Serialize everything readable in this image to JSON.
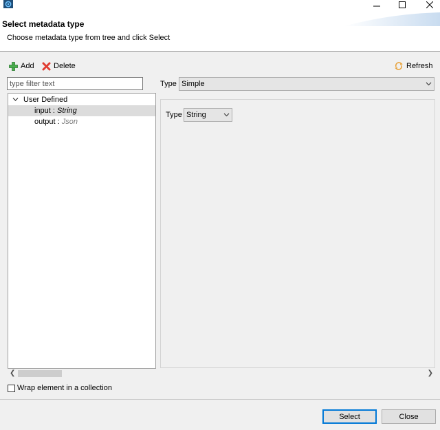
{
  "window": {
    "title_icon": "gear-app-icon",
    "controls": {
      "minimize_icon": "minimize-icon",
      "maximize_icon": "maximize-icon",
      "close_icon": "close-icon"
    }
  },
  "header": {
    "title": "Select metadata type",
    "subtitle": "Choose metadata type from tree and click Select"
  },
  "toolbar": {
    "add_label": "Add",
    "add_icon": "plus-icon",
    "delete_label": "Delete",
    "delete_icon": "delete-x-icon",
    "refresh_label": "Refresh",
    "refresh_icon": "refresh-icon"
  },
  "filter": {
    "placeholder": "type filter text",
    "value": ""
  },
  "tree": {
    "root": {
      "label": "User Defined",
      "expanded": true
    },
    "items": [
      {
        "name": "input",
        "separator": " : ",
        "type": "String",
        "selected": true
      },
      {
        "name": "output",
        "separator": " : ",
        "type": "Json",
        "selected": false
      }
    ]
  },
  "type_panel": {
    "type_label": "Type",
    "type_value": "Simple",
    "inner_type_label": "Type",
    "inner_type_value": "String"
  },
  "options": {
    "wrap_label": "Wrap element in a collection",
    "wrap_checked": false
  },
  "buttons": {
    "select_label": "Select",
    "close_label": "Close"
  },
  "colors": {
    "accent": "#0078d7",
    "delete_red": "#e03c31",
    "add_green": "#4caf50",
    "refresh_orange": "#e8a33d"
  }
}
